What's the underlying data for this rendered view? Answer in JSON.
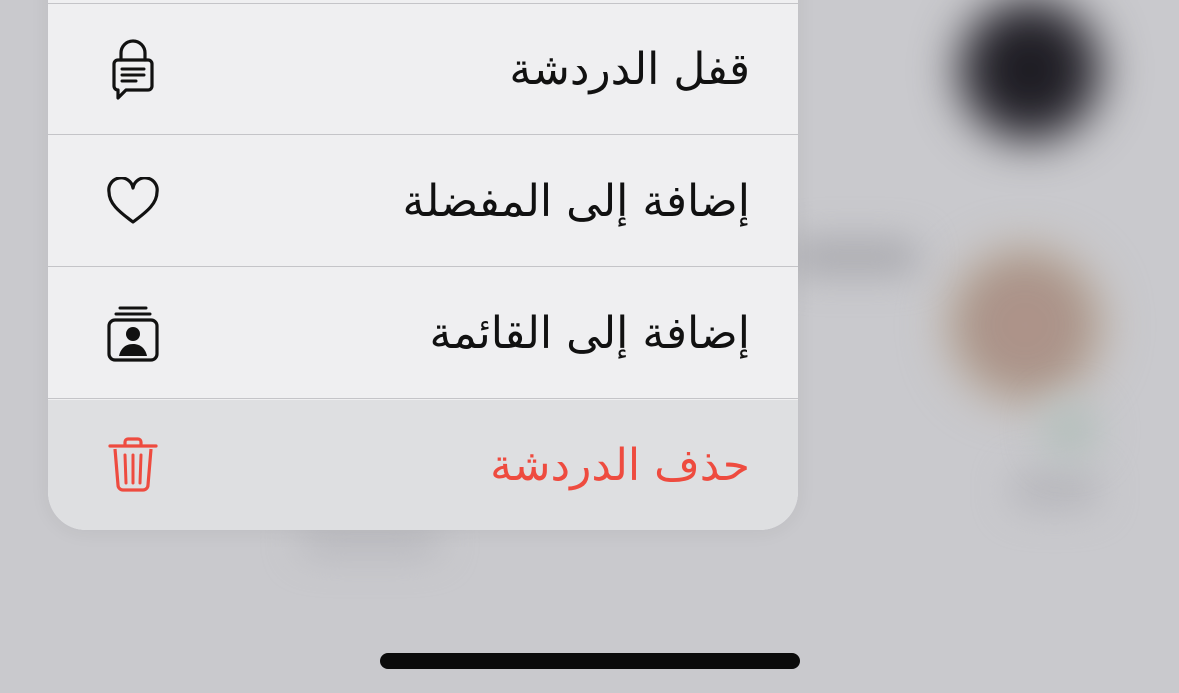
{
  "menu": {
    "items": [
      {
        "label": "قفل الدردشة",
        "icon": "lock-chat-icon"
      },
      {
        "label": "إضافة إلى المفضلة",
        "icon": "heart-icon"
      },
      {
        "label": "إضافة إلى القائمة",
        "icon": "contact-list-icon"
      },
      {
        "label": "حذف الدردشة",
        "icon": "trash-icon",
        "color": "#ee4b3f"
      }
    ]
  }
}
